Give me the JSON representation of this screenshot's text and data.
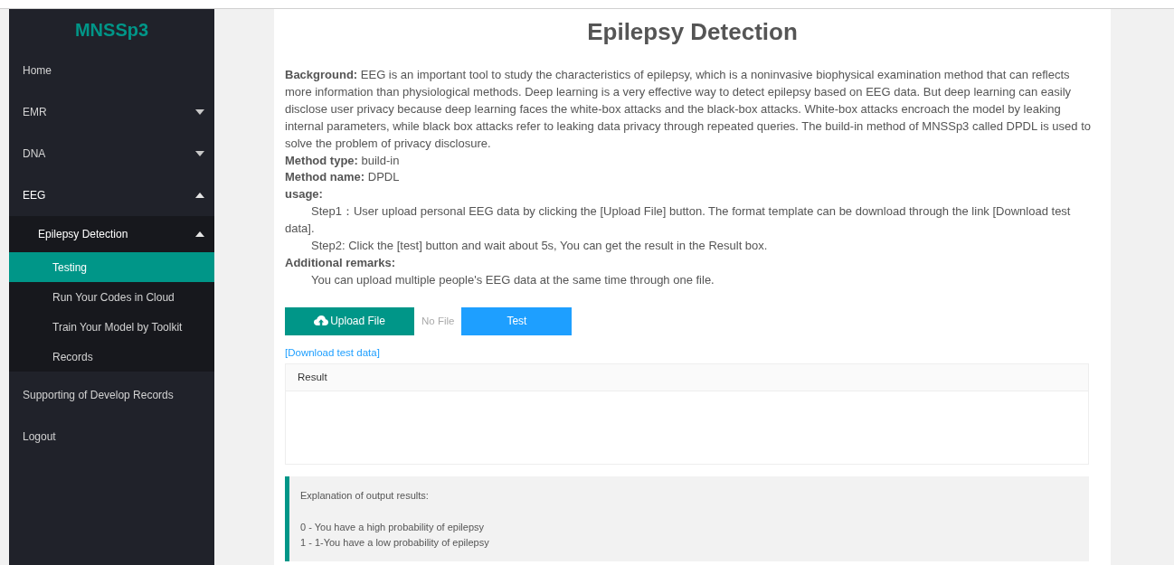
{
  "sidebar": {
    "brand": "MNSSp3",
    "items": [
      {
        "label": "Home",
        "kind": "link",
        "selected": false
      },
      {
        "label": "EMR",
        "kind": "menu",
        "expanded": false,
        "selected": false
      },
      {
        "label": "DNA",
        "kind": "menu",
        "expanded": false,
        "selected": false
      },
      {
        "label": "EEG",
        "kind": "menu",
        "expanded": true,
        "selected": false,
        "children": [
          {
            "label": "Epilepsy Detection",
            "kind": "menu",
            "expanded": true,
            "selected": false,
            "children": [
              {
                "label": "Testing",
                "kind": "link",
                "selected": true
              },
              {
                "label": "Run Your Codes in Cloud",
                "kind": "link",
                "selected": false
              },
              {
                "label": "Train Your Model by Toolkit",
                "kind": "link",
                "selected": false
              },
              {
                "label": "Records",
                "kind": "link",
                "selected": false
              }
            ]
          }
        ]
      },
      {
        "label": "Supporting of Develop Records",
        "kind": "link",
        "selected": false
      },
      {
        "label": "Logout",
        "kind": "link",
        "selected": false
      }
    ]
  },
  "main": {
    "title": "Epilepsy Detection",
    "description": [
      {
        "kind": "paragraph",
        "text": "**Background:** EEG is an important tool to study the characteristics of epilepsy, which is a noninvasive biophysical examination method that can reflects more information than physiological methods. Deep learning is a very effective way to detect epilepsy based on EEG data. But deep learning can easily disclose user privacy because deep learning faces the white-box attacks and the black-box attacks. White-box attacks encroach the model by leaking internal parameters, while black box attacks refer to leaking data privacy through repeated queries. The build-in method of MNSSp3 called DPDL is used to solve the problem of privacy disclosure."
      },
      {
        "kind": "paragraph",
        "text": "**Method type:** build-in"
      },
      {
        "kind": "paragraph",
        "text": "**Method name:** DPDL"
      },
      {
        "kind": "heading",
        "text": "usage:"
      },
      {
        "kind": "indented",
        "text": "Step1：User upload personal EEG data by clicking the [Upload File] button. The format template can be download through the link [Download test data]."
      },
      {
        "kind": "indented",
        "text": "Step2: Click the [test] button and wait about 5s, You can get the result in the Result box."
      },
      {
        "kind": "heading",
        "text": "Additional remarks:"
      },
      {
        "kind": "indented",
        "text": "You can upload multiple people's EEG data at the same time through one file."
      }
    ],
    "upload_button": "Upload File",
    "file_status": "No File",
    "test_button": "Test",
    "download_link": "[Download test data]",
    "result_panel": {
      "title": "Result"
    },
    "explanation": {
      "heading": "Explanation of output results:",
      "lines": [
        "0 - You have a high probability of epilepsy",
        "1 - 1-You have a low probability of epilepsy"
      ]
    }
  }
}
